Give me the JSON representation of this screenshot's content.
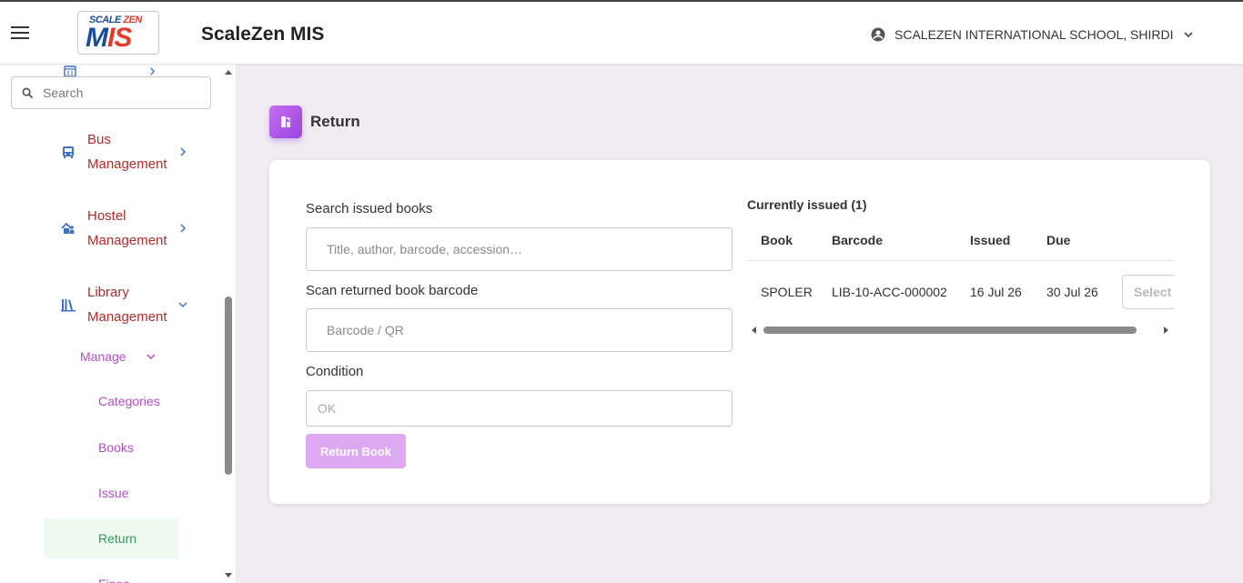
{
  "header": {
    "logo_top_scale": "SCALE",
    "logo_top_zen": "ZEN",
    "logo_main_m": "M",
    "logo_main_is": "IS",
    "app_title": "ScaleZen MIS",
    "school_name": "SCALEZEN INTERNATIONAL SCHOOL, SHIRDI",
    "icons": {
      "menu": "hamburger-menu-icon",
      "user": "account-circle-icon",
      "expand": "chevron-down-icon"
    }
  },
  "sidebar": {
    "search_placeholder": "Search",
    "items": [
      {
        "line1": "Bus",
        "line2": "Management",
        "icon": "bus-icon"
      },
      {
        "line1": "Hostel",
        "line2": "Management",
        "icon": "hostel-icon"
      },
      {
        "line1": "Library",
        "line2": "Management",
        "icon": "library-icon",
        "expanded": true
      }
    ],
    "submenu": {
      "label": "Manage",
      "links": [
        {
          "label": "Categories"
        },
        {
          "label": "Books"
        },
        {
          "label": "Issue"
        },
        {
          "label": "Return",
          "active": true
        },
        {
          "label": "Fines"
        }
      ]
    }
  },
  "page": {
    "title": "Return",
    "icon": "return-book-icon"
  },
  "form": {
    "search_label": "Search issued books",
    "search_placeholder": "Title, author, barcode, accession…",
    "scan_label": "Scan returned book barcode",
    "scan_placeholder": "Barcode / QR",
    "condition_label": "Condition",
    "condition_placeholder": "OK",
    "submit_label": "Return Book"
  },
  "issued": {
    "title": "Currently issued (1)",
    "columns": [
      "Book",
      "Barcode",
      "Issued",
      "Due"
    ],
    "rows": [
      {
        "book": "SPOLER",
        "barcode": "LIB-10-ACC-000002",
        "issued": "16 Jul 26",
        "due": "30 Jul 26",
        "action": "Select"
      }
    ]
  },
  "colors": {
    "accent_purple": "#b44cc9",
    "nav_red": "#b22b2b",
    "active_green": "#2e9a56",
    "button_purple": "#dfa8f3"
  }
}
